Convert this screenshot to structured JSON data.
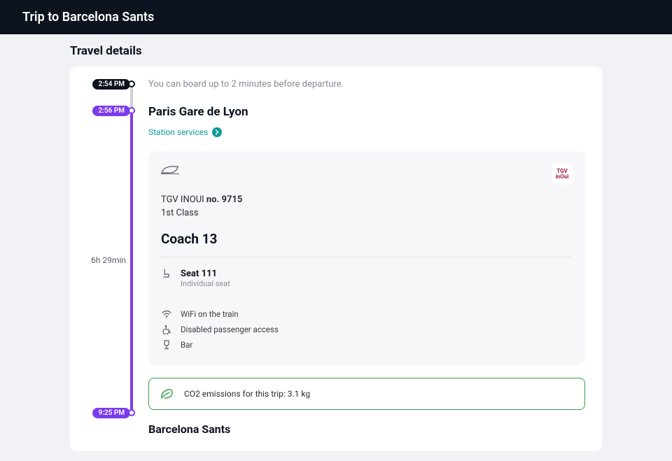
{
  "header": {
    "title": "Trip to Barcelona Sants"
  },
  "section": {
    "title": "Travel details"
  },
  "boarding": {
    "time": "2:54 PM",
    "note": "You can board up to 2 minutes before departure."
  },
  "departure": {
    "time": "2:56 PM",
    "station": "Paris Gare de Lyon",
    "services_link": "Station services"
  },
  "duration": "6h 29min",
  "train": {
    "brand_label": "TGV INOUI",
    "prefix": "TGV INOUI ",
    "number_label": "no. 9715",
    "class": "1st Class",
    "coach": "Coach 13",
    "seat": {
      "number": "Seat 111",
      "type": "Individual seat"
    },
    "amenities": {
      "wifi": "WiFi on the train",
      "access": "Disabled passenger access",
      "bar": "Bar"
    }
  },
  "co2": {
    "text": "CO2 emissions for this trip: 3.1 kg"
  },
  "arrival": {
    "time": "9:25 PM",
    "station": "Barcelona Sants"
  }
}
